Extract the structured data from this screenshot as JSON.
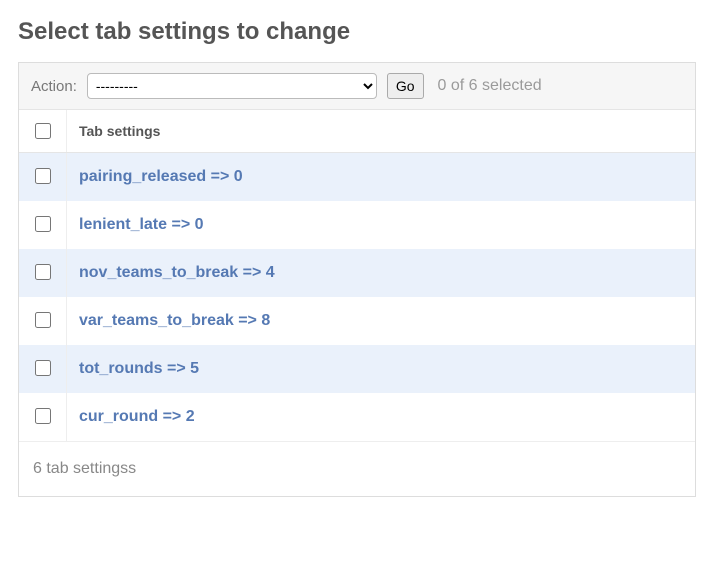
{
  "page_title": "Select tab settings to change",
  "actions": {
    "label": "Action:",
    "placeholder": "---------",
    "go_label": "Go",
    "selection_text": "0 of 6 selected"
  },
  "table": {
    "header": "Tab settings",
    "rows": [
      {
        "text": "pairing_released => 0"
      },
      {
        "text": "lenient_late => 0"
      },
      {
        "text": "nov_teams_to_break => 4"
      },
      {
        "text": "var_teams_to_break => 8"
      },
      {
        "text": "tot_rounds => 5"
      },
      {
        "text": "cur_round => 2"
      }
    ]
  },
  "paginator_text": "6 tab settingss"
}
